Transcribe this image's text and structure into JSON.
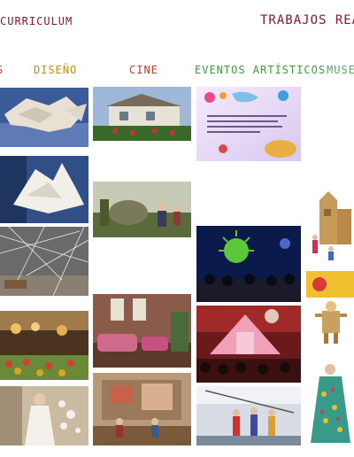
{
  "header": {
    "curriculum_link": "CURRICULUM",
    "trabajos_title": "TRABAJOS REA"
  },
  "categories": [
    {
      "label": "S",
      "color": "#c0392b"
    },
    {
      "label": "DISEÑO",
      "color": "#c58b12"
    },
    {
      "label": "CINE",
      "color": "#c0392b"
    },
    {
      "label": "EVENTOS ARTÍSTICOS",
      "color": "#3d9a3d"
    },
    {
      "label": "MUSE",
      "color": "#56a86b"
    }
  ],
  "colors": {
    "header_text": "#8b1538"
  },
  "thumbnails": {
    "diseno": [
      "paper-fish-sculpture",
      "paper-angel-sculpture",
      "paper-building-sculpture",
      "string-installation",
      "market-stall",
      "woman-dress-installation"
    ],
    "cine": [
      "house-facade",
      "garden-figures",
      "pink-living-room",
      "wall-mural-room"
    ],
    "eventos": [
      "illustrated-flyer",
      "concert-stage-green",
      "pink-tent-event",
      "circus-performers"
    ],
    "museo": [
      "cardboard-castle",
      "museum-poster",
      "wooden-puppet",
      "costume-figure"
    ]
  }
}
